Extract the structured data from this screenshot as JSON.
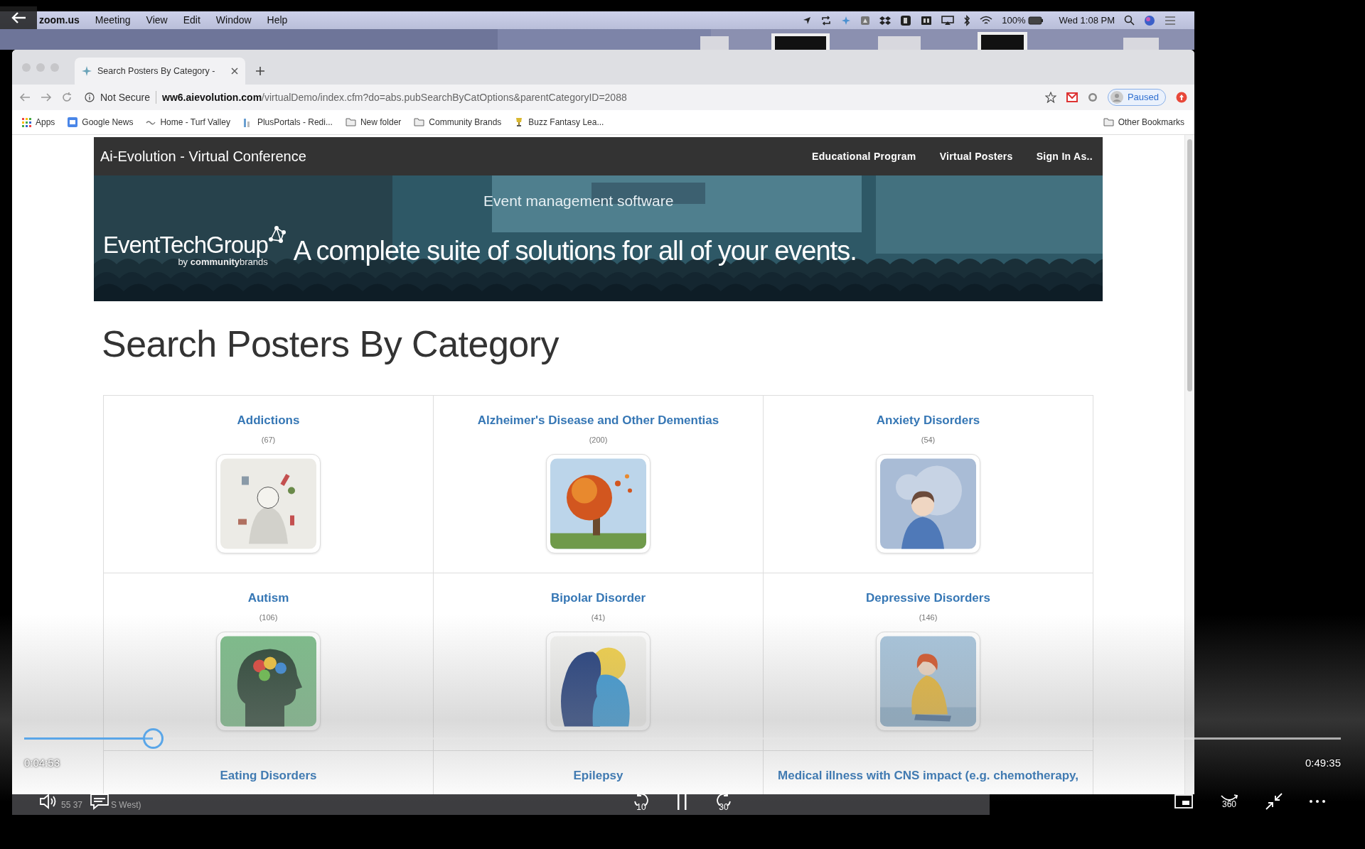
{
  "menu_bar": {
    "app": "zoom.us",
    "menus": [
      "Meeting",
      "View",
      "Edit",
      "Window",
      "Help"
    ],
    "battery": "100%",
    "clock": "Wed 1:08 PM"
  },
  "browser": {
    "tab": {
      "title": "Search Posters By Category -"
    },
    "address": {
      "security": "Not Secure",
      "url": "**ww6.aievolution.com**/virtualDemo/index.cfm?do=abs.pubSearchByCatOptions&parentCategoryID=2088"
    },
    "profile": "Paused",
    "bookmarks": [
      {
        "label": "Apps",
        "kind": "grid"
      },
      {
        "label": "Google News",
        "kind": "news"
      },
      {
        "label": "Home - Turf Valley",
        "kind": "wave"
      },
      {
        "label": "PlusPortals - Redi...",
        "kind": "bars"
      },
      {
        "label": "New folder",
        "kind": "folder"
      },
      {
        "label": "Community Brands",
        "kind": "folder"
      },
      {
        "label": "Buzz Fantasy Lea...",
        "kind": "trophy"
      }
    ],
    "other_bookmarks": "Other Bookmarks"
  },
  "site": {
    "brand": "Ai-Evolution - Virtual Conference",
    "nav": [
      "Educational Program",
      "Virtual Posters",
      "Sign In As.."
    ],
    "banner": {
      "tagline": "Event management software",
      "logo": "EventTechGroup",
      "logo_sub": "by **community**brands",
      "headline": "A complete suite of solutions for all of your events."
    },
    "heading": "Search Posters By Category",
    "categories": [
      {
        "name": "Addictions",
        "count": "(67)",
        "kind": "picture"
      },
      {
        "name": "Alzheimer's Disease and Other Dementias",
        "count": "(200)",
        "kind": "picture"
      },
      {
        "name": "Anxiety Disorders",
        "count": "(54)",
        "kind": "picture"
      },
      {
        "name": "Autism",
        "count": "(106)",
        "kind": "picture"
      },
      {
        "name": "Bipolar Disorder",
        "count": "(41)",
        "kind": "picture"
      },
      {
        "name": "Depressive Disorders",
        "count": "(146)",
        "kind": "picture"
      },
      {
        "name": "Eating Disorders",
        "kind": "title"
      },
      {
        "name": "Epilepsy",
        "kind": "title"
      },
      {
        "name": "Medical illness with CNS impact (e.g. chemotherapy,",
        "kind": "title"
      }
    ]
  },
  "background_strip": [
    "55 37",
    "S West)"
  ],
  "player": {
    "elapsed": "0:04:53",
    "duration": "0:49:35",
    "level": 0.098,
    "skip_back": "10",
    "skip_forward": "30",
    "view_360": "360"
  }
}
